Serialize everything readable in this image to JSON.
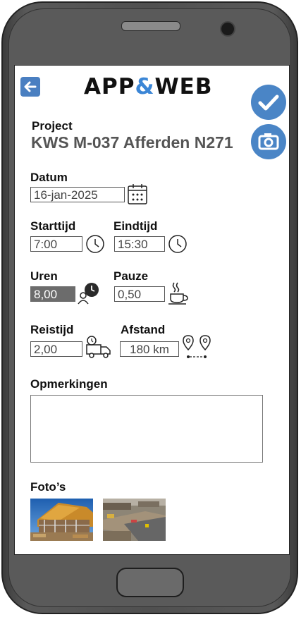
{
  "app": {
    "logo_left": "APP",
    "logo_amp": "&",
    "logo_right": "WEB"
  },
  "header": {
    "back_icon": "arrow-left-icon",
    "confirm_icon": "checkmark-icon",
    "camera_icon": "camera-icon"
  },
  "project": {
    "label": "Project",
    "name": "KWS M-037 Afferden N271"
  },
  "datum": {
    "label": "Datum",
    "value": "16-jan-2025",
    "icon": "calendar-icon"
  },
  "starttijd": {
    "label": "Starttijd",
    "value": "7:00",
    "icon": "clock-icon"
  },
  "eindtijd": {
    "label": "Eindtijd",
    "value": "15:30",
    "icon": "clock-icon"
  },
  "uren": {
    "label": "Uren",
    "value": "8,00",
    "icon": "person-clock-icon"
  },
  "pauze": {
    "label": "Pauze",
    "value": "0,50",
    "icon": "coffee-cup-icon"
  },
  "reistijd": {
    "label": "Reistijd",
    "value": "2,00",
    "icon": "truck-clock-icon"
  },
  "afstand": {
    "label": "Afstand",
    "value": "180 km",
    "icon": "route-pins-icon"
  },
  "opmerkingen": {
    "label": "Opmerkingen",
    "value": ""
  },
  "fotos": {
    "label": "Foto’s",
    "items": [
      "house-construction-photo",
      "road-construction-photo"
    ]
  },
  "colors": {
    "accent": "#4a85c6",
    "logo_amp": "#3b86d6",
    "filled_field": "#6c6c6c"
  }
}
